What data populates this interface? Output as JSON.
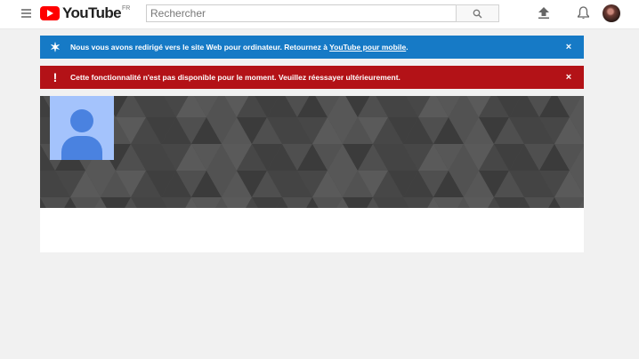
{
  "header": {
    "logo_text": "YouTube",
    "country_code": "FR",
    "search": {
      "placeholder": "Rechercher",
      "value": ""
    }
  },
  "alerts": {
    "info": {
      "text": "Nous vous avons redirigé vers le site Web pour ordinateur. Retournez à ",
      "link_text": "YouTube pour mobile",
      "suffix": ".",
      "close": "×"
    },
    "error": {
      "text": "Cette fonctionnalité n'est pas disponible pour le moment. Veuillez réessayer ultérieurement.",
      "close": "×"
    }
  },
  "icons": {
    "menu": "menu-icon",
    "search": "search-icon",
    "upload": "upload-icon",
    "notifications": "bell-icon",
    "info_alert": "star-icon",
    "error_alert": "exclamation-icon"
  },
  "colors": {
    "brand_red": "#ff0000",
    "info_blue": "#167ac6",
    "error_red": "#b31217",
    "banner_gray": "#4d4d4d",
    "avatar_bg": "#a4c3fc",
    "avatar_fg": "#4a82e0"
  }
}
